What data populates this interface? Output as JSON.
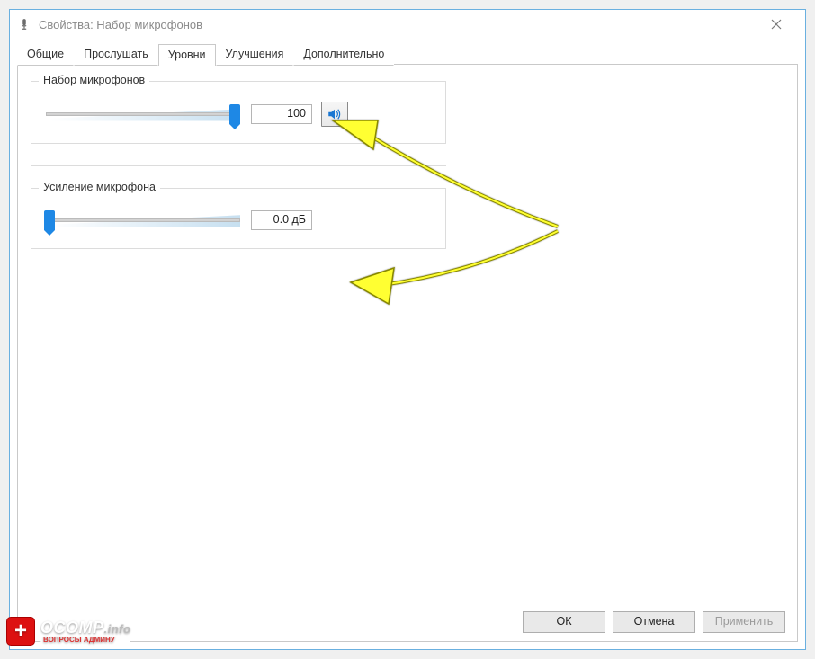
{
  "window": {
    "title": "Свойства: Набор микрофонов"
  },
  "tabs": {
    "t0": "Общие",
    "t1": "Прослушать",
    "t2": "Уровни",
    "t3": "Улучшения",
    "t4": "Дополнительно",
    "active_index": 2
  },
  "group_mic_array": {
    "legend": "Набор микрофонов",
    "level_value": "100",
    "slider_percent": 100,
    "muted": false
  },
  "group_mic_boost": {
    "legend": "Усиление микрофона",
    "level_value": "0.0 дБ",
    "slider_percent": 0
  },
  "buttons": {
    "ok": "ОК",
    "cancel": "Отмена",
    "apply": "Применить"
  },
  "watermark": {
    "line1_main": "OCOMP",
    "line1_suffix": ".info",
    "line2": "ВОПРОСЫ АДМИНУ"
  }
}
